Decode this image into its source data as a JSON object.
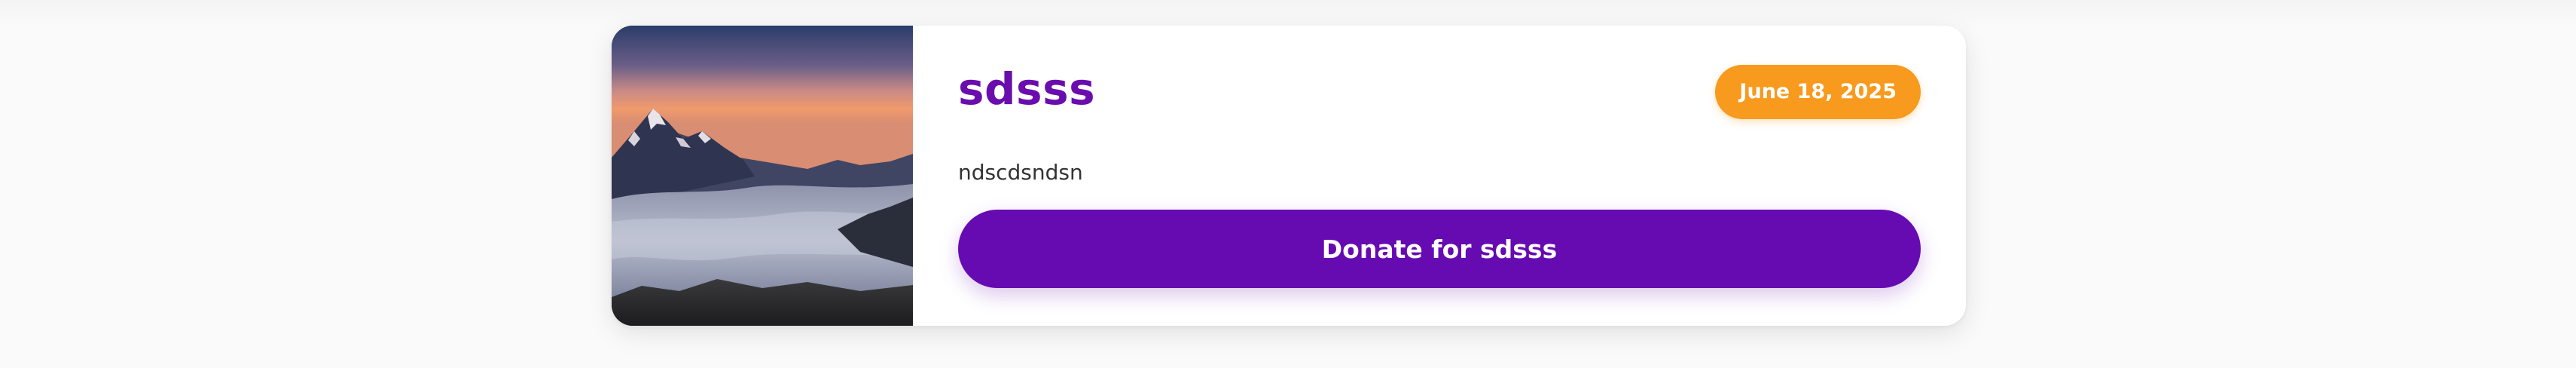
{
  "campaign": {
    "title": "sdsss",
    "date": "June 18, 2025",
    "description": "ndscdsndsn",
    "donate_label": "Donate for sdsss",
    "image": "mountain-sea-of-clouds-photo"
  },
  "colors": {
    "accent": "#660ab2",
    "title": "#6a0dad",
    "badge": "#f89a1d",
    "text": "#333333"
  }
}
